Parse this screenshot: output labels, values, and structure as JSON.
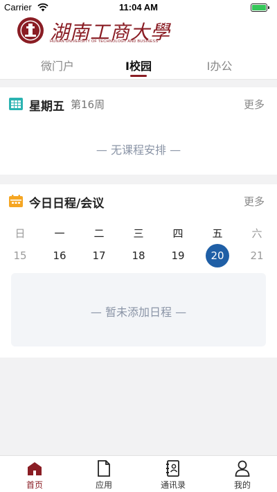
{
  "status_bar": {
    "carrier": "Carrier",
    "time": "11:04 AM"
  },
  "header": {
    "logo_cn": "湖南工商大學",
    "logo_en": "HUNAN UNIVERSITY OF TECHNOLOGY AND BUSINESS",
    "tabs": [
      {
        "label": "微门户"
      },
      {
        "label": "I校园"
      },
      {
        "label": "I办公"
      }
    ]
  },
  "timetable_card": {
    "title": "星期五",
    "week": "第16周",
    "more": "更多",
    "empty": "—   无课程安排   —"
  },
  "schedule_card": {
    "title": "今日日程/会议",
    "more": "更多",
    "weekdays": [
      "日",
      "一",
      "二",
      "三",
      "四",
      "五",
      "六"
    ],
    "dates": [
      "15",
      "16",
      "17",
      "18",
      "19",
      "20",
      "21"
    ],
    "selected_date": "20",
    "empty": "—   暂未添加日程   —"
  },
  "tabbar": {
    "items": [
      {
        "label": "首页",
        "icon": "home-icon"
      },
      {
        "label": "应用",
        "icon": "document-icon"
      },
      {
        "label": "通讯录",
        "icon": "contacts-icon"
      },
      {
        "label": "我的",
        "icon": "user-icon"
      }
    ]
  },
  "colors": {
    "brand": "#8a1d24",
    "selected": "#1f5fa6",
    "teal": "#2bb3b1",
    "orange": "#f5a623"
  }
}
